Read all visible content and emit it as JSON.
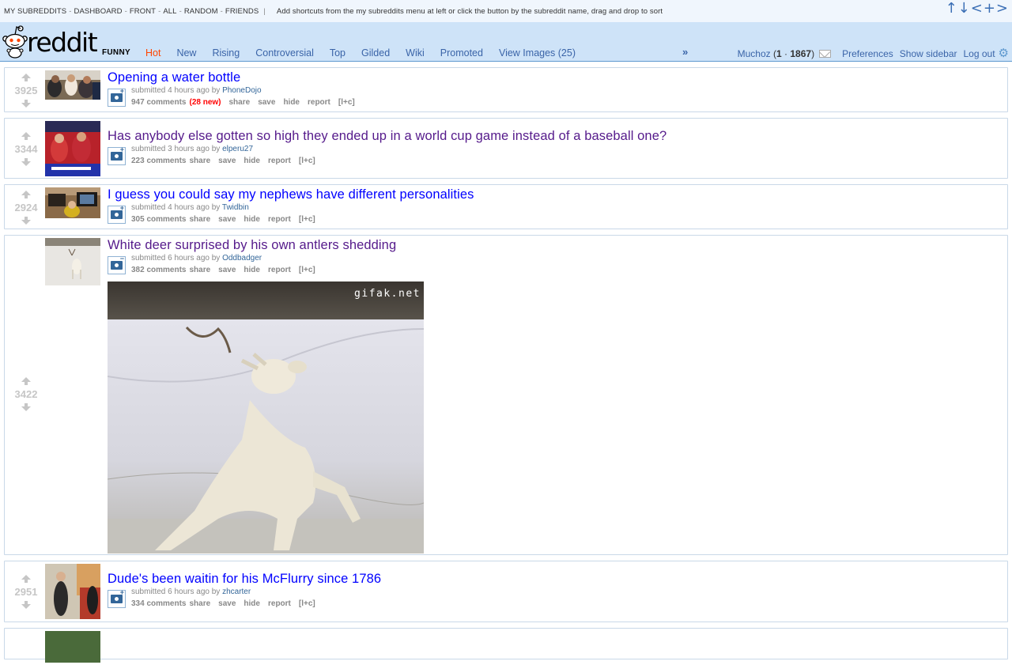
{
  "shortcut_bar": {
    "links": [
      "MY SUBREDDITS",
      "DASHBOARD",
      "FRONT",
      "ALL",
      "RANDOM",
      "FRIENDS"
    ],
    "hint": "Add shortcuts from the my subreddits menu at left or click the button by the subreddit name, drag and drop to sort",
    "controls": "↑↓<+>"
  },
  "header": {
    "logo_text": "reddit",
    "subreddit_name": "FUNNY",
    "tabs": [
      {
        "label": "Hot",
        "selected": true
      },
      {
        "label": "New",
        "selected": false
      },
      {
        "label": "Rising",
        "selected": false
      },
      {
        "label": "Controversial",
        "selected": false
      },
      {
        "label": "Top",
        "selected": false
      },
      {
        "label": "Gilded",
        "selected": false
      },
      {
        "label": "Wiki",
        "selected": false
      },
      {
        "label": "Promoted",
        "selected": false
      },
      {
        "label": "View Images (25)",
        "selected": false
      }
    ],
    "more_arrow": "»",
    "user": {
      "name": "Muchoz",
      "karma_link": "1",
      "karma_comment": "1867",
      "preferences": "Preferences",
      "show_sidebar": "Show sidebar",
      "logout": "Log out"
    }
  },
  "posts": [
    {
      "score": "3925",
      "title": "Opening a water bottle",
      "visited": false,
      "submitted": "submitted 4 hours ago by",
      "author": "PhoneDojo",
      "comments": "947 comments",
      "new_count": "(28 new)",
      "actions": [
        "share",
        "save",
        "hide",
        "report",
        "[l+c]"
      ]
    },
    {
      "score": "3344",
      "title": "Has anybody else gotten so high they ended up in a world cup game instead of a baseball one?",
      "visited": true,
      "submitted": "submitted 3 hours ago by",
      "author": "elperu27",
      "comments": "223 comments",
      "new_count": "",
      "actions": [
        "share",
        "save",
        "hide",
        "report",
        "[l+c]"
      ]
    },
    {
      "score": "2924",
      "title": "I guess you could say my nephews have different personalities",
      "visited": false,
      "submitted": "submitted 4 hours ago by",
      "author": "Twidbin",
      "comments": "305 comments",
      "new_count": "",
      "actions": [
        "share",
        "save",
        "hide",
        "report",
        "[l+c]"
      ]
    },
    {
      "score": "3422",
      "title": "White deer surprised by his own antlers shedding",
      "visited": true,
      "submitted": "submitted 6 hours ago by",
      "author": "Oddbadger",
      "comments": "382 comments",
      "new_count": "",
      "actions": [
        "share",
        "save",
        "hide",
        "report",
        "[l+c]"
      ],
      "expando_watermark": "gifak.net"
    },
    {
      "score": "2951",
      "title": "Dude's been waitin for his McFlurry since 1786",
      "visited": false,
      "submitted": "submitted 6 hours ago by",
      "author": "zhcarter",
      "comments": "334 comments",
      "new_count": "",
      "actions": [
        "share",
        "save",
        "hide",
        "report",
        "[l+c]"
      ]
    }
  ],
  "colors": {
    "link": "#0000ff",
    "visited": "#551a8b",
    "header_bg": "#cee3f8",
    "accent_hot": "#ff4500",
    "score_gray": "#c6c6c6"
  }
}
